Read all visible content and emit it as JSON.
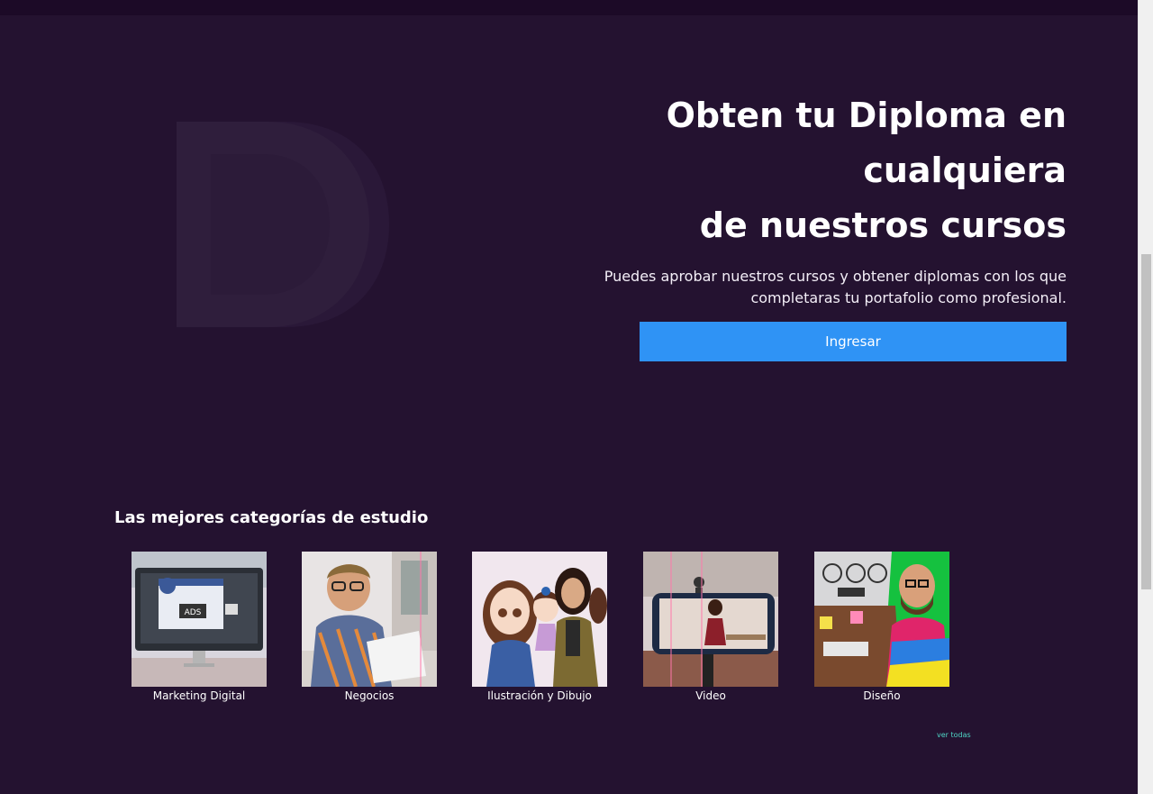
{
  "hero": {
    "title_lines": [
      "Obten tu Diploma en",
      "cualquiera",
      "de nuestros cursos"
    ],
    "subtitle_line1": "Puedes aprobar nuestros cursos y obtener diplomas con los que",
    "subtitle_line2": "completaras tu portafolio como profesional.",
    "button_label": "Ingresar",
    "button_color": "#2f93f5"
  },
  "categories": {
    "title": "Las mejores categorías de estudio",
    "items": [
      {
        "label": "Marketing Digital",
        "image_text": "ADS"
      },
      {
        "label": "Negocios"
      },
      {
        "label": "Ilustración y Dibujo"
      },
      {
        "label": "Video"
      },
      {
        "label": "Diseño"
      }
    ],
    "see_all": "ver todas"
  },
  "colors": {
    "background": "#241230",
    "topbar": "#1c0a27",
    "link": "#4fd6c6"
  }
}
